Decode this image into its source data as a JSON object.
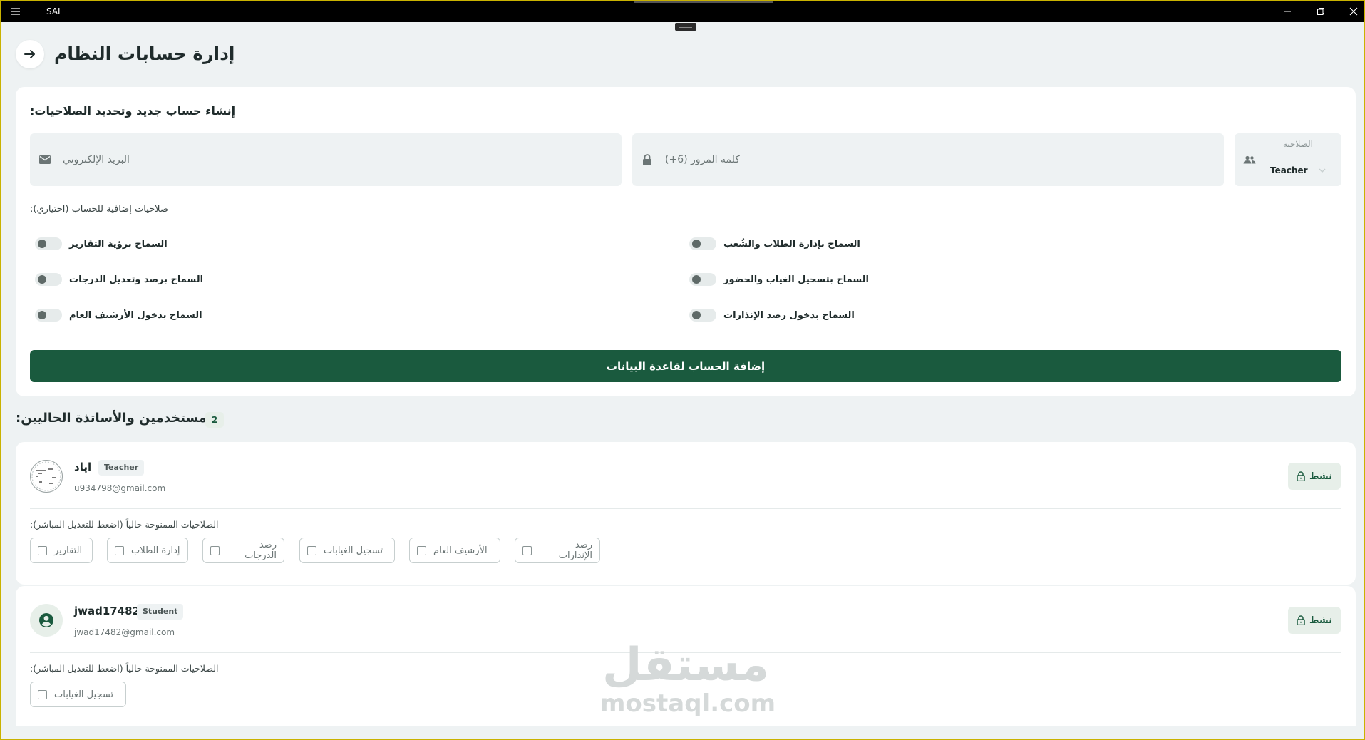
{
  "window": {
    "title": "SAL"
  },
  "page": {
    "title": "إدارة حسابات النظام"
  },
  "create_form": {
    "section_title": "إنشاء حساب جديد وتحديد الصلاحيات:",
    "email_placeholder": "البريد الإلكتروني",
    "password_placeholder": "كلمة المرور (6+)",
    "role_label": "الصلاحية",
    "role_value": "Teacher",
    "extra_permissions_title": "صلاحيات إضافية للحساب (اختياري):",
    "toggles": [
      {
        "label": "السماح بإدارة الطلاب والشُعب",
        "checked": false
      },
      {
        "label": "السماح برؤية التقارير",
        "checked": false
      },
      {
        "label": "السماح بتسجيل الغياب والحضور",
        "checked": false
      },
      {
        "label": "السماح برصد وتعديل الدرجات",
        "checked": false
      },
      {
        "label": "السماح بدخول رصد الإنذارات",
        "checked": false
      },
      {
        "label": "السماح بدخول الأرشيف العام",
        "checked": false
      }
    ],
    "submit_label": "إضافة الحساب لقاعدة البيانات"
  },
  "users_section": {
    "title": "المستخدمين والأساتذة الحاليين:",
    "count": "2"
  },
  "users": [
    {
      "name": "اياد",
      "role": "Teacher",
      "email": "u934798@gmail.com",
      "status": "نشط",
      "granted_title": "الصلاحيات الممنوحة حالياً (اضغط للتعديل المباشر):",
      "permissions": [
        "رصد الإنذارات",
        "الأرشيف العام",
        "تسجيل الغيابات",
        "رصد الدرجات",
        "إدارة الطلاب",
        "التقارير"
      ]
    },
    {
      "name": "jwad17482",
      "role": "Student",
      "email": "jwad17482@gmail.com",
      "status": "نشط",
      "granted_title": "الصلاحيات الممنوحة حالياً (اضغط للتعديل المباشر):",
      "permissions": [
        "تسجيل الغيابات"
      ]
    }
  ],
  "watermark": {
    "arabic": "مستقل",
    "latin": "mostaql.com"
  },
  "colors": {
    "primary": "#1a5a3e",
    "background": "#eef2f3",
    "titlebar": "#000000",
    "window_border": "#c9b200"
  }
}
